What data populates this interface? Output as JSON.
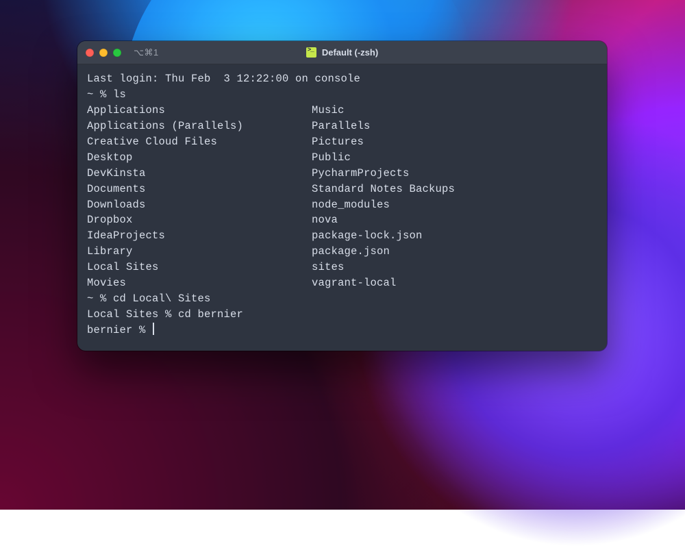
{
  "window": {
    "tab_hint": "⌥⌘1",
    "title": "Default (-zsh)"
  },
  "terminal": {
    "last_login": "Last login: Thu Feb  3 12:22:00 on console",
    "prompt1": "~ % ls",
    "ls_left": [
      "Applications",
      "Applications (Parallels)",
      "Creative Cloud Files",
      "Desktop",
      "DevKinsta",
      "Documents",
      "Downloads",
      "Dropbox",
      "IdeaProjects",
      "Library",
      "Local Sites",
      "Movies"
    ],
    "ls_right": [
      "Music",
      "Parallels",
      "Pictures",
      "Public",
      "PycharmProjects",
      "Standard Notes Backups",
      "node_modules",
      "nova",
      "package-lock.json",
      "package.json",
      "sites",
      "vagrant-local"
    ],
    "prompt2": "~ % cd Local\\ Sites",
    "prompt3": "Local Sites % cd bernier",
    "prompt4": "bernier % "
  }
}
